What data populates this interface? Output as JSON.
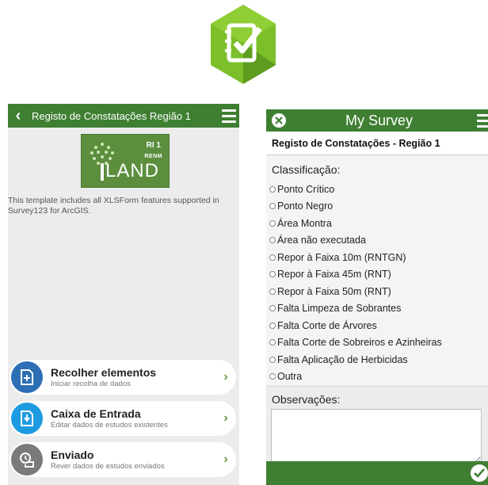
{
  "left_screen": {
    "header": {
      "title": "Registo de Constatações Região 1",
      "back_icon": "chevron-left-icon",
      "menu_icon": "hamburger-menu-icon"
    },
    "logo": {
      "badge": "RI 1",
      "subtext": "RENM",
      "word": "LAND"
    },
    "description": "This template includes all XLSForm features supported in Survey123 for ArcGIS.",
    "menu": [
      {
        "label": "Recolher elementos",
        "sub": "Iniciar recolha de dados",
        "icon": "collect-icon",
        "color": "#2d6fb5"
      },
      {
        "label": "Caixa de Entrada",
        "sub": "Editar dados de estudos existentes",
        "icon": "inbox-icon",
        "color": "#1e9be0"
      },
      {
        "label": "Enviado",
        "sub": "Rever dados de estudos enviados",
        "icon": "sent-icon",
        "color": "#7a7a7a"
      }
    ],
    "chevron": "›"
  },
  "right_screen": {
    "header": {
      "title": "My Survey",
      "close_icon": "close-icon",
      "menu_icon": "hamburger-menu-icon"
    },
    "survey_title": "Registo de Constatações - Região 1",
    "classification_label": "Classificação:",
    "options": [
      "Ponto Crítico",
      "Ponto Negro",
      "Área Montra",
      "Área não executada",
      "Repor à Faixa 10m (RNTGN)",
      "Repor à Faixa 45m (RNT)",
      "Repor à Faixa 50m (RNT)",
      "Falta Limpeza de Sobrantes",
      "Falta Corte de Árvores",
      "Falta Corte de Sobreiros e Azinheiras",
      "Falta Aplicação de Herbicidas",
      "Outra"
    ],
    "observations_label": "Observações:",
    "observations_value": "",
    "submit_icon": "checkmark-icon"
  },
  "colors": {
    "header_green": "#3f7f32",
    "logo_green": "#5c8e3e"
  }
}
